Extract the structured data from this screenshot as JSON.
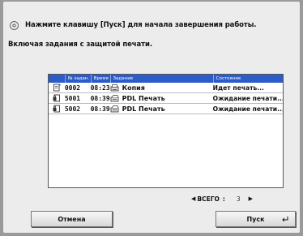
{
  "header": {
    "message": "Нажмите клавишу [Пуск] для начала завершения работы.",
    "subtext": "Включая задания с защитой печати."
  },
  "table": {
    "columns": [
      "№ задан.",
      "Время",
      "Задание",
      "Состояние"
    ],
    "rows": [
      {
        "icon": "copy-job-icon",
        "num": "0002",
        "time": "08:23",
        "job_icon": "copy-icon",
        "job": "Копия",
        "status": "Идет печать..."
      },
      {
        "icon": "secure-print-icon",
        "num": "5001",
        "time": "08:39",
        "job_icon": "pdl-print-icon",
        "job": "PDL  Печать",
        "status": "Ожидание печати..."
      },
      {
        "icon": "secure-print-icon",
        "num": "5002",
        "time": "08:39",
        "job_icon": "pdl-print-icon",
        "job": "PDL  Печать",
        "status": "Ожидание печати..."
      }
    ]
  },
  "pager": {
    "label": "ВСЕГО",
    "separator": ":",
    "total": "3"
  },
  "buttons": {
    "cancel": "Отмена",
    "start": "Пуск"
  }
}
